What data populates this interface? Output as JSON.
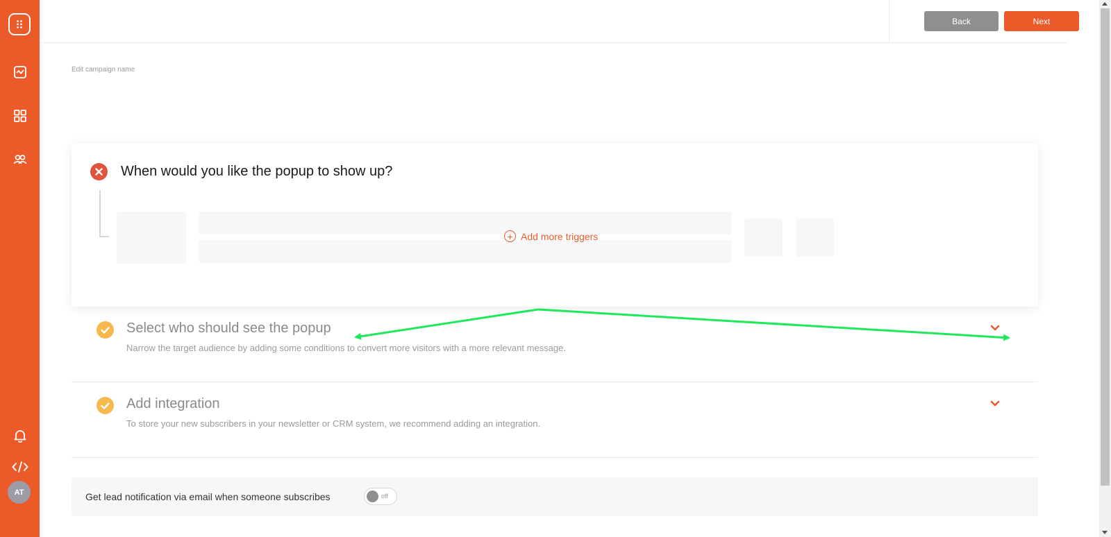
{
  "colors": {
    "brand": "#ed5a29",
    "error": "#e0533d",
    "success": "#f7b84d",
    "annotation": "#1fe85c"
  },
  "sidebar": {
    "items": [
      {
        "icon": "app-logo-icon"
      },
      {
        "icon": "activity-chart-icon"
      },
      {
        "icon": "grid-icon"
      },
      {
        "icon": "users-icon"
      },
      {
        "icon": "bell-icon"
      },
      {
        "icon": "code-icon"
      }
    ],
    "avatar_initials": "AT"
  },
  "header": {
    "back_label": "Back",
    "next_label": "Next"
  },
  "campaign": {
    "edit_name_label": "Edit campaign name"
  },
  "trigger_card": {
    "title": "When would you like the popup to show up?",
    "add_triggers_label": "Add more triggers",
    "status_icon": "error-x-icon"
  },
  "sections": [
    {
      "title": "Select who should see the popup",
      "description": "Narrow the target audience by adding some conditions to convert more visitors with a more relevant message.",
      "status_icon": "check-icon"
    },
    {
      "title": "Add integration",
      "description": "To store your new subscribers in your newsletter or CRM system, we recommend adding an integration.",
      "status_icon": "check-icon"
    }
  ],
  "lead_notification": {
    "label": "Get lead notification via email when someone subscribes",
    "toggle_text": "off",
    "enabled": false
  }
}
